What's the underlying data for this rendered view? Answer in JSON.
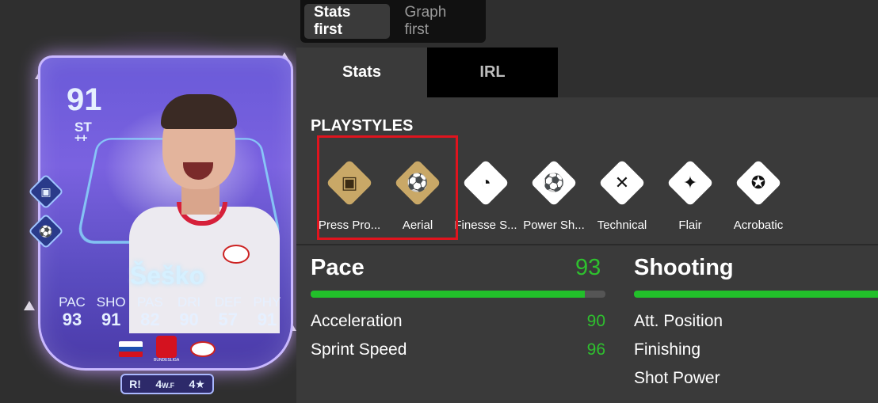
{
  "card": {
    "rating": "91",
    "position": "ST",
    "position_rank": "++",
    "name": "Šeško",
    "stats": [
      {
        "key": "PAC",
        "val": "93"
      },
      {
        "key": "SHO",
        "val": "91"
      },
      {
        "key": "PAS",
        "val": "82"
      },
      {
        "key": "DRI",
        "val": "90"
      },
      {
        "key": "DEF",
        "val": "57"
      },
      {
        "key": "PHY",
        "val": "91"
      }
    ],
    "badges": {
      "foot": "R",
      "weak_foot": "4",
      "weak_foot_unit": "W.F",
      "skills": "4"
    },
    "league_label": "BUNDESLIGA"
  },
  "toggle": {
    "stats_first": "Stats first",
    "graph_first": "Graph first"
  },
  "tabs": {
    "stats": "Stats",
    "irl": "IRL"
  },
  "playstyles": {
    "title": "PLAYSTYLES",
    "items": [
      {
        "label": "Press Pro...",
        "icon": "press-proven-icon",
        "plus": true
      },
      {
        "label": "Aerial",
        "icon": "aerial-icon",
        "plus": true
      },
      {
        "label": "Finesse S...",
        "icon": "finesse-shot-icon",
        "plus": false
      },
      {
        "label": "Power Sh...",
        "icon": "power-shot-icon",
        "plus": false
      },
      {
        "label": "Technical",
        "icon": "technical-icon",
        "plus": false
      },
      {
        "label": "Flair",
        "icon": "flair-icon",
        "plus": false
      },
      {
        "label": "Acrobatic",
        "icon": "acrobatic-icon",
        "plus": false
      }
    ]
  },
  "pace": {
    "name": "Pace",
    "value": "93",
    "fill_pct": 93,
    "attributes": [
      {
        "name": "Acceleration",
        "value": "90"
      },
      {
        "name": "Sprint Speed",
        "value": "96"
      }
    ]
  },
  "shooting": {
    "name": "Shooting",
    "attributes": [
      {
        "name": "Att. Position"
      },
      {
        "name": "Finishing"
      },
      {
        "name": "Shot Power"
      }
    ]
  },
  "colors": {
    "accent_green": "#22c02a",
    "highlight_red": "#e0141e",
    "gold": "#c9a867"
  }
}
